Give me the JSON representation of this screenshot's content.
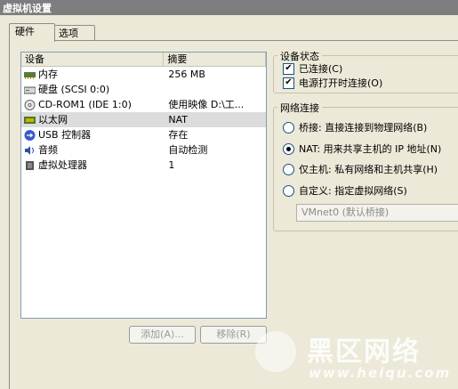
{
  "window": {
    "title": "虚拟机设置"
  },
  "tabs": [
    {
      "label": "硬件"
    },
    {
      "label": "选项"
    }
  ],
  "device_list": {
    "columns": [
      "设备",
      "摘要"
    ],
    "rows": [
      {
        "device": "内存",
        "summary": "256 MB",
        "icon": "memory-icon"
      },
      {
        "device": "硬盘 (SCSI 0:0)",
        "summary": "",
        "icon": "hard-disk-icon"
      },
      {
        "device": "CD-ROM1 (IDE 1:0)",
        "summary": "使用映像 D:\\工...",
        "icon": "cdrom-icon"
      },
      {
        "device": "以太网",
        "summary": "NAT",
        "icon": "ethernet-icon",
        "selected": true
      },
      {
        "device": "USB 控制器",
        "summary": "存在",
        "icon": "usb-icon"
      },
      {
        "device": "音频",
        "summary": "自动检测",
        "icon": "audio-icon"
      },
      {
        "device": "虚拟处理器",
        "summary": "1",
        "icon": "processor-icon"
      }
    ]
  },
  "buttons": {
    "add": "添加(A)...",
    "remove": "移除(R)"
  },
  "device_status": {
    "title": "设备状态",
    "connected": "已连接(C)",
    "connect_at_power_on": "电源打开时连接(O)"
  },
  "network": {
    "title": "网络连接",
    "bridged": "桥接: 直接连接到物理网络(B)",
    "nat": "NAT: 用来共享主机的 IP 地址(N)",
    "host_only": "仅主机: 私有网络和主机共享(H)",
    "custom": "自定义: 指定虚拟网络(S)",
    "custom_value": "VMnet0 (默认桥接)",
    "selected": "nat"
  },
  "watermark": {
    "brand": "黑区网络",
    "url": "www.heiqu.com"
  }
}
